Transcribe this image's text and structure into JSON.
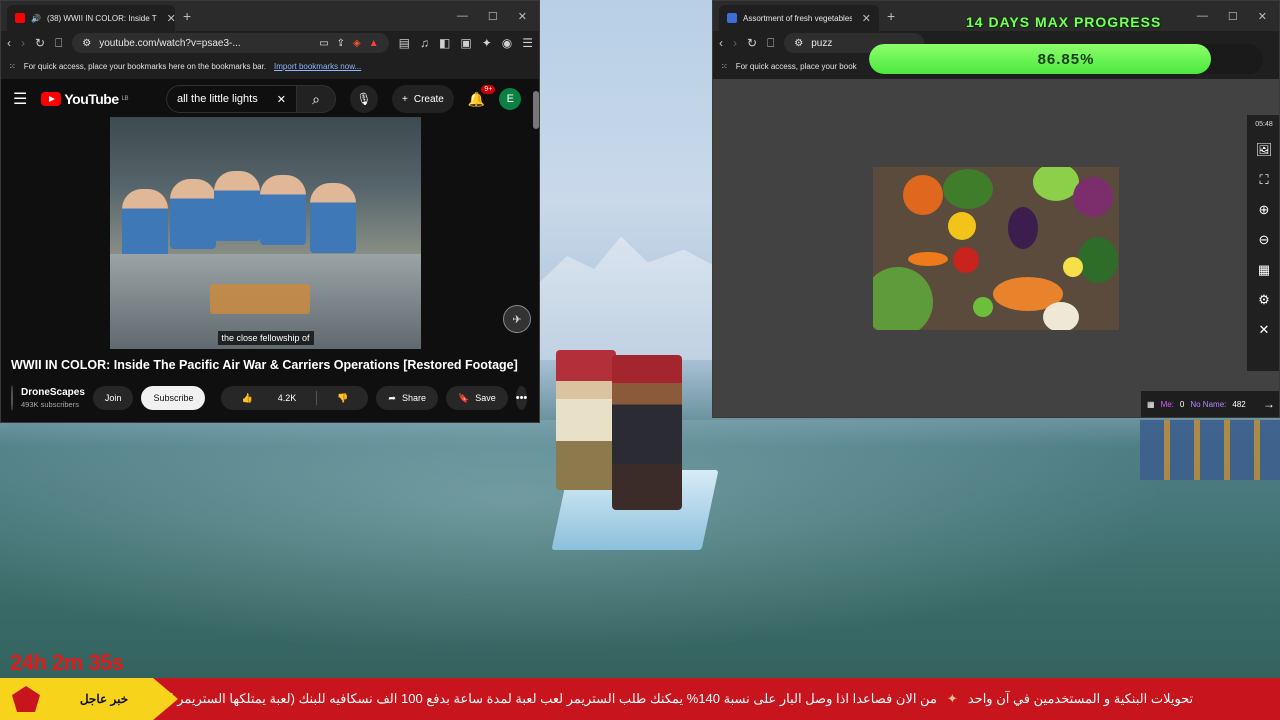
{
  "youtube_window": {
    "tab_title": "(38) WWII IN COLOR: Inside T",
    "url": "youtube.com/watch?v=psae3-...",
    "brave_badge": "",
    "bookmarks_hint": "For quick access, place your bookmarks here on the bookmarks bar.",
    "bookmarks_link": "Import bookmarks now...",
    "logo": "YouTube",
    "logo_region": "LB",
    "search_value": "all the little lights",
    "create_label": "Create",
    "notif_badge": "9+",
    "avatar_letter": "E",
    "caption": "the close fellowship of",
    "video_title": "WWII IN COLOR: Inside The Pacific Air War & Carriers Operations [Restored Footage]",
    "channel_name": "DroneScapes",
    "channel_subs": "493K subscribers",
    "join_label": "Join",
    "subscribe_label": "Subscribe",
    "likes": "4.2K",
    "share_label": "Share",
    "save_label": "Save"
  },
  "image_window": {
    "tab_title": "Assortment of fresh vegetables",
    "url": "puzz",
    "bookmarks_hint": "For quick access, place your book",
    "time": "05:48",
    "chat_me_label": "Me:",
    "chat_me_value": "0",
    "chat_noname_label": "No Name:",
    "chat_noname_value": "482"
  },
  "overlay": {
    "progress_title": "14 DAYS MAX PROGRESS",
    "progress_text": "86.85%",
    "progress_value": 86.85,
    "timer": "24h 2m 35s",
    "ticker_label": "خبر عاجل",
    "ticker_text_1": "من الان فصاعدا اذا وصل البار على نسبة 140% يمكنك طلب الستريمر لعب لعبة لمدة ساعة بدفع 100 الف نسكافيه للبنك (لعبة يمتلكها الستريمر ا",
    "ticker_text_2": "تحويلات البنكية و المستخدمين في آن واحد"
  },
  "colors": {
    "progress_green": "#4be83f",
    "ticker_red": "#c8141d",
    "ticker_yellow": "#f8d31b",
    "timer_red": "#e01b1b"
  }
}
